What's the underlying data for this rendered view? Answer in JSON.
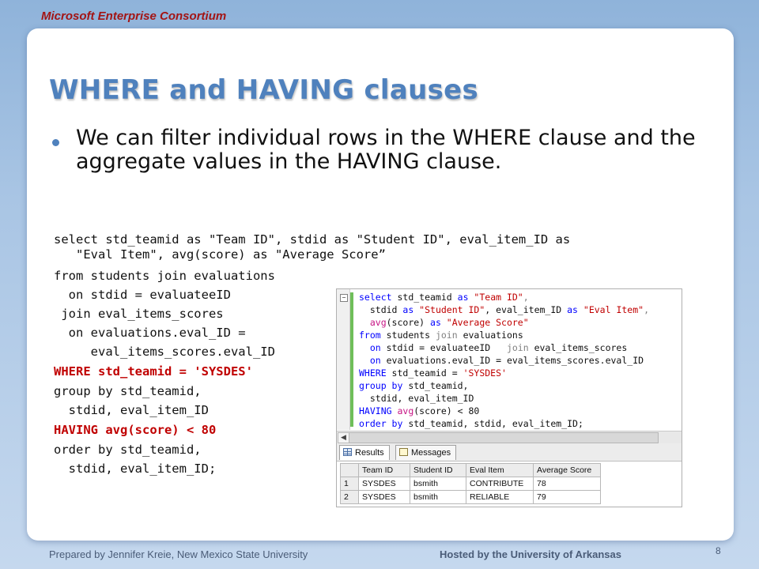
{
  "header": {
    "brand": "Microsoft Enterprise Consortium"
  },
  "slide": {
    "title": "WHERE and HAVING clauses",
    "bullet": "We can filter individual rows in the WHERE clause and the aggregate values in the HAVING clause.",
    "code_lines": [
      "select std_teamid as \"Team ID\", stdid as \"Student ID\", eval_item_ID as",
      "   \"Eval Item\", avg(score) as \"Average Score”",
      "from students join evaluations",
      "  on stdid = evaluateeID",
      " join eval_items_scores",
      "  on evaluations.eval_ID =",
      "     eval_items_scores.eval_ID",
      "WHERE std_teamid = 'SYSDES'",
      "group by std_teamid,",
      "  stdid, eval_item_ID",
      "HAVING avg(score) < 80",
      "order by std_teamid,",
      "  stdid, eval_item_ID;"
    ]
  },
  "ssms": {
    "editor": {
      "l1": {
        "a": "select",
        "b": " std_teamid ",
        "c": "as",
        "d": " \"Team ID\"",
        "e": ","
      },
      "l2": {
        "a": "  stdid ",
        "b": "as",
        "c": " \"Student ID\"",
        "d": ", eval_item_ID ",
        "e": "as",
        "f": " \"Eval Item\"",
        "g": ","
      },
      "l3": {
        "a": "  avg",
        "b": "(score) ",
        "c": "as",
        "d": " \"Average Score\""
      },
      "l4": {
        "a": "from",
        "b": " students ",
        "c": "join",
        "d": " evaluations"
      },
      "l5": {
        "a": "  on",
        "b": " stdid = evaluateeID   ",
        "c": "join",
        "d": " eval_items_scores"
      },
      "l6": {
        "a": "  on",
        "b": " evaluations.eval_ID = eval_items_scores.eval_ID"
      },
      "l7": {
        "a": "WHERE",
        "b": " std_teamid = ",
        "c": "'SYSDES'"
      },
      "l8": {
        "a": "group by",
        "b": " std_teamid,"
      },
      "l9": {
        "a": "  stdid, eval_item_ID"
      },
      "l10": {
        "a": "HAVING",
        "b": " avg",
        "c": "(score) < 80"
      },
      "l11": {
        "a": "order by",
        "b": " std_teamid, stdid, eval_item_ID;"
      }
    },
    "tabs": {
      "results": "Results",
      "messages": "Messages"
    },
    "table": {
      "headers": [
        "Team ID",
        "Student ID",
        "Eval Item",
        "Average Score"
      ],
      "rows": [
        {
          "num": "1",
          "cells": [
            "SYSDES",
            "bsmith",
            "CONTRIBUTE",
            "78"
          ]
        },
        {
          "num": "2",
          "cells": [
            "SYSDES",
            "bsmith",
            "RELIABLE",
            "79"
          ]
        }
      ]
    }
  },
  "footer": {
    "left": "Prepared by Jennifer Kreie, New Mexico State University",
    "right": "Hosted by the University of Arkansas",
    "page": "8"
  },
  "colors": {
    "title": "#4f81bd",
    "keyword_red": "#c00000",
    "sql_keyword": "#0000ff"
  }
}
